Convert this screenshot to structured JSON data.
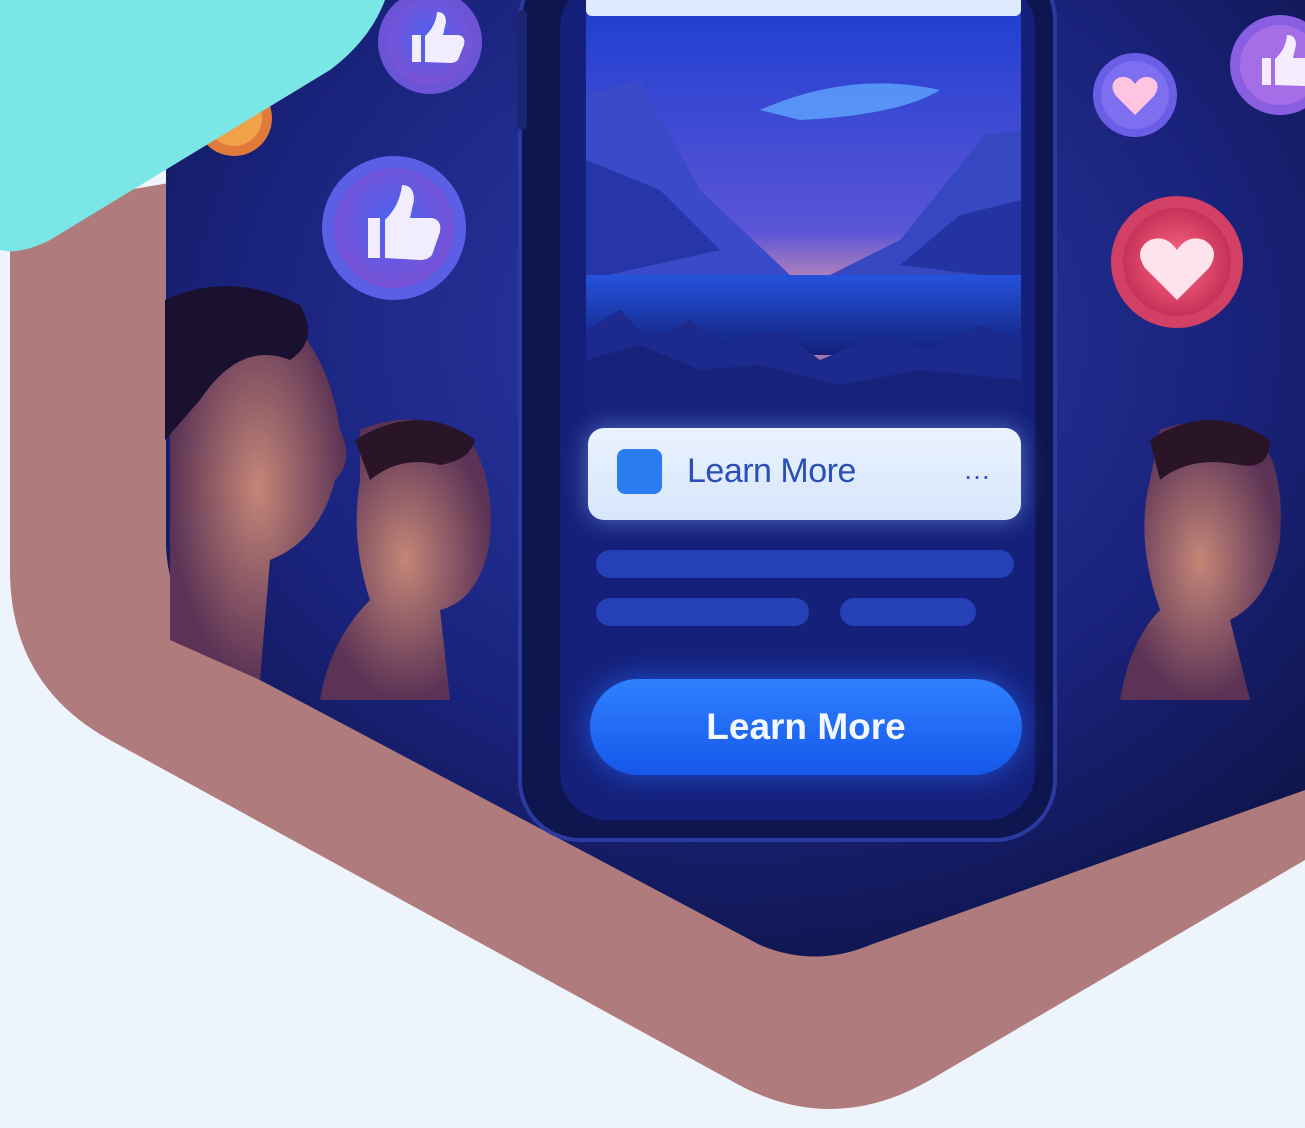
{
  "ad_card": {
    "label": "Learn More",
    "more_icon": "…"
  },
  "cta": {
    "label": "Learn More"
  },
  "colors": {
    "background": "#eef4fb",
    "hex_frame": "#b07b7c",
    "teal_blob": "#7be6e6",
    "scene_dark": "#121a4a",
    "accent_blue": "#2a7cf0",
    "heart_red": "#e24b6a"
  },
  "icons": [
    "thumbs-up-icon",
    "heart-icon",
    "more-icon"
  ]
}
